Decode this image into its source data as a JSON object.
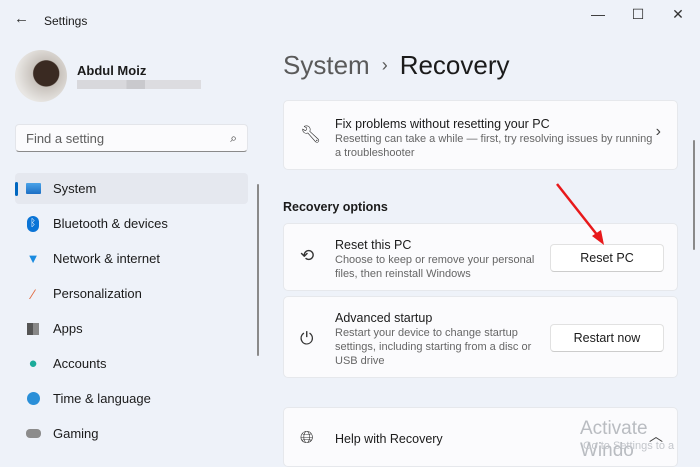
{
  "window": {
    "title": "Settings"
  },
  "user": {
    "name": "Abdul Moiz"
  },
  "search": {
    "placeholder": "Find a setting"
  },
  "nav": [
    {
      "label": "System",
      "icon": "monitor-icon",
      "active": true
    },
    {
      "label": "Bluetooth & devices",
      "icon": "bluetooth-icon"
    },
    {
      "label": "Network & internet",
      "icon": "wifi-icon"
    },
    {
      "label": "Personalization",
      "icon": "brush-icon"
    },
    {
      "label": "Apps",
      "icon": "apps-icon"
    },
    {
      "label": "Accounts",
      "icon": "person-icon"
    },
    {
      "label": "Time & language",
      "icon": "globe-clock-icon"
    },
    {
      "label": "Gaming",
      "icon": "gamepad-icon"
    }
  ],
  "breadcrumb": {
    "parent": "System",
    "separator": "›",
    "current": "Recovery"
  },
  "fix": {
    "title": "Fix problems without resetting your PC",
    "desc": "Resetting can take a while — first, try resolving issues by running a troubleshooter"
  },
  "section_title": "Recovery options",
  "reset": {
    "title": "Reset this PC",
    "desc": "Choose to keep or remove your personal files, then reinstall Windows",
    "button": "Reset PC"
  },
  "advanced": {
    "title": "Advanced startup",
    "desc": "Restart your device to change startup settings, including starting from a disc or USB drive",
    "button": "Restart now"
  },
  "help": {
    "title": "Help with Recovery"
  },
  "watermark": {
    "line1": "Activate Windo",
    "line2": "Go to Settings to a"
  },
  "colors": {
    "accent": "#0067c0",
    "arrow": "#e8191b"
  }
}
